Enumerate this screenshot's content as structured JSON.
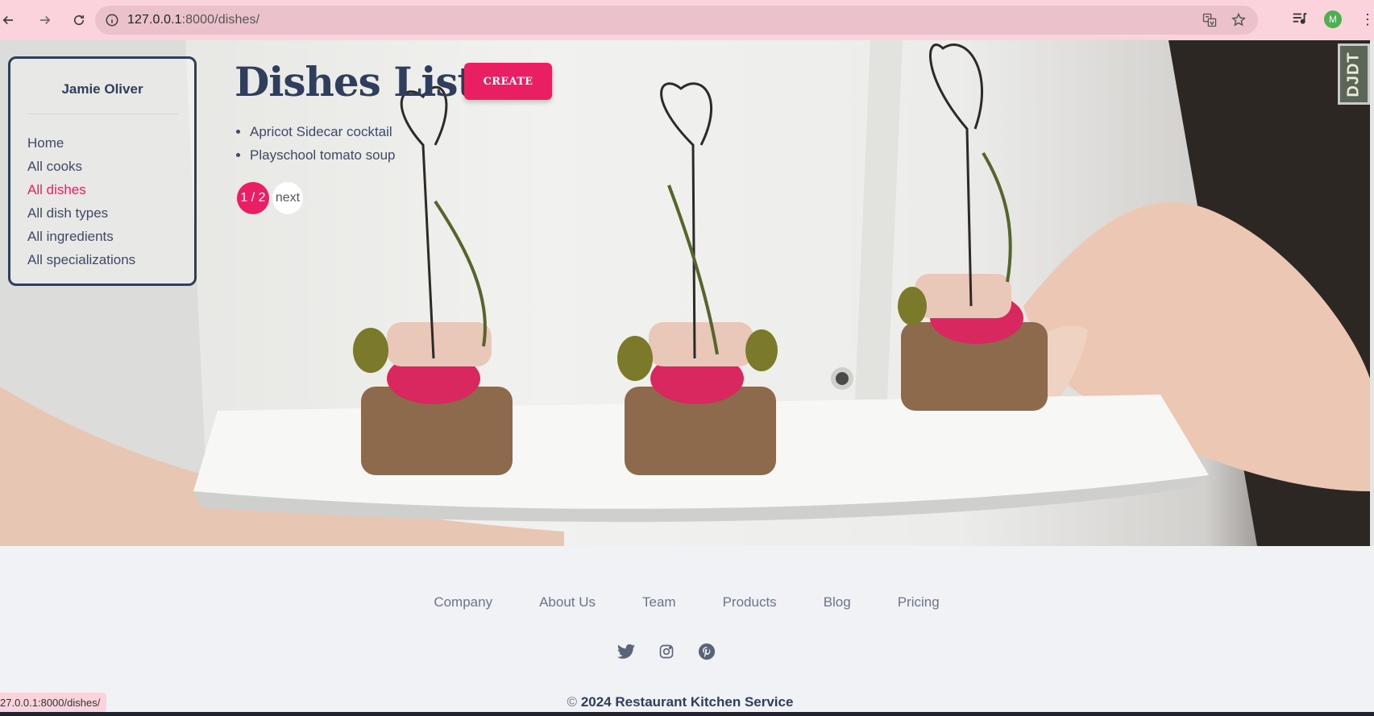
{
  "browser": {
    "url_host": "127.0.0.1",
    "url_path": ":8000/dishes/",
    "profile_initial": "M",
    "icons": [
      "back-arrow-icon",
      "forward-arrow-icon",
      "reload-icon",
      "site-info-icon",
      "translate-icon",
      "bookmark-star-icon",
      "media-control-icon",
      "kebab-menu-icon"
    ]
  },
  "sidebar": {
    "user_name": "Jamie Oliver",
    "items": [
      {
        "label": "Home"
      },
      {
        "label": "All cooks"
      },
      {
        "label": "All dishes"
      },
      {
        "label": "All dish types"
      },
      {
        "label": "All ingredients"
      },
      {
        "label": "All specializations"
      }
    ],
    "active_item": "All dishes"
  },
  "main": {
    "title": "Dishes List",
    "create_label": "CREATE",
    "dishes": [
      "Apricot Sidecar cocktail",
      "Playschool tomato soup"
    ],
    "pagination": {
      "current": "1 / 2",
      "next_label": "next"
    }
  },
  "debug_toolbar": {
    "label": "DJDT"
  },
  "footer": {
    "links": [
      "Company",
      "About Us",
      "Team",
      "Products",
      "Blog",
      "Pricing"
    ],
    "socials": [
      "twitter-icon",
      "instagram-icon",
      "pinterest-icon"
    ],
    "copyright_symbol": "©",
    "copyright_text": "2024 Restaurant Kitchen Service"
  },
  "status_bar": {
    "url": "27.0.0.1:8000/dishes/"
  },
  "colors": {
    "accent": "#e91e63",
    "navy": "#2f3e5c",
    "chrome": "#fbd3dc"
  }
}
